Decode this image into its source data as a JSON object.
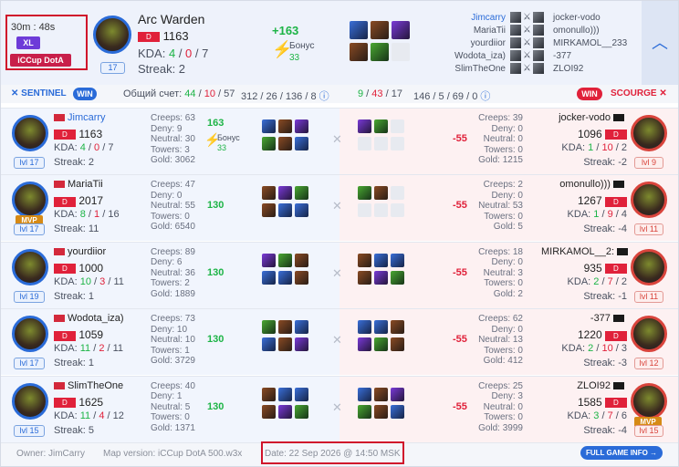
{
  "header": {
    "duration": "30m : 48s",
    "size_badge": "XL",
    "mode_badge": "iCCup DotA",
    "hero": "Arc Warden",
    "rating": "1163",
    "kda_label": "KDA:",
    "kda": [
      "4",
      "0",
      "7"
    ],
    "streak": "Streak: 2",
    "level": "17",
    "delta": "+163",
    "bonus_label": "Бонус",
    "bonus_value": "33"
  },
  "player_lists": {
    "left": [
      "Jimcarry",
      "MariaTii",
      "yourdiior",
      "Wodota_iza)",
      "SlimTheOne"
    ],
    "right": [
      "jocker-vodo",
      "omonullo)))",
      "MIRKAMOL__233",
      "-377",
      "ZLOI92"
    ]
  },
  "summary": {
    "sentinel": "SENTINEL",
    "win": "WIN",
    "score_label": "Общий счет:",
    "score": [
      "44",
      "10",
      "57"
    ],
    "left_stats": "312 / 26 / 136 / 8",
    "right_score": [
      "9",
      "43",
      "17"
    ],
    "right_stats": "146 / 5 / 69 / 0",
    "right_win": "WIN",
    "scourge": "SCOURGE"
  },
  "rows": [
    {
      "lname": "Jimcarry",
      "lrating": "1163",
      "lkda": [
        "4",
        "0",
        "7"
      ],
      "lstreak": "Streak: 2",
      "llvl": "lvl 17",
      "lstats": [
        "Creeps: 63",
        "Deny: 9",
        "Neutral: 30",
        "Towers: 3",
        "Gold: 3062"
      ],
      "ldelta": "163",
      "lbonus": "Бонус",
      "lbonusv": "33",
      "rstats": [
        "Creeps: 39",
        "Deny: 0",
        "Neutral: 0",
        "Towers: 0",
        "Gold: 1215"
      ],
      "rdelta": "-55",
      "rname": "jocker-vodo",
      "rrating": "1096",
      "rkda": [
        "1",
        "10",
        "2"
      ],
      "rstreak": "Streak: -2",
      "rlvl": "lvl 9"
    },
    {
      "lname": "MariaTii",
      "lrating": "2017",
      "lkda": [
        "8",
        "1",
        "16"
      ],
      "lstreak": "Streak: 11",
      "llvl": "lvl 17",
      "lmvp": "MVP",
      "lstats": [
        "Creeps: 47",
        "Deny: 0",
        "Neutral: 55",
        "Towers: 0",
        "Gold: 6540"
      ],
      "ldelta": "130",
      "rstats": [
        "Creeps: 2",
        "Deny: 0",
        "Neutral: 53",
        "Towers: 0",
        "Gold: 5"
      ],
      "rdelta": "-55",
      "rname": "omonullo)))",
      "rrating": "1267",
      "rkda": [
        "1",
        "9",
        "4"
      ],
      "rstreak": "Streak: -4",
      "rlvl": "lvl 11"
    },
    {
      "lname": "yourdiior",
      "lrating": "1000",
      "lkda": [
        "10",
        "3",
        "11"
      ],
      "lstreak": "Streak: 1",
      "llvl": "lvl 19",
      "lstats": [
        "Creeps: 89",
        "Deny: 6",
        "Neutral: 36",
        "Towers: 2",
        "Gold: 1889"
      ],
      "ldelta": "130",
      "rstats": [
        "Creeps: 18",
        "Deny: 0",
        "Neutral: 3",
        "Towers: 0",
        "Gold: 2"
      ],
      "rdelta": "-55",
      "rname": "MIRKAMOL__2:",
      "rrating": "935",
      "rkda": [
        "2",
        "7",
        "2"
      ],
      "rstreak": "Streak: -1",
      "rlvl": "lvl 11"
    },
    {
      "lname": "Wodota_iza)",
      "lrating": "1059",
      "lkda": [
        "11",
        "2",
        "11"
      ],
      "lstreak": "Streak: 1",
      "llvl": "lvl 17",
      "lstats": [
        "Creeps: 73",
        "Deny: 10",
        "Neutral: 10",
        "Towers: 1",
        "Gold: 3729"
      ],
      "ldelta": "130",
      "rstats": [
        "Creeps: 62",
        "Deny: 0",
        "Neutral: 13",
        "Towers: 0",
        "Gold: 412"
      ],
      "rdelta": "-55",
      "rname": "-377",
      "rrating": "1220",
      "rkda": [
        "2",
        "10",
        "3"
      ],
      "rstreak": "Streak: -3",
      "rlvl": "lvl 12"
    },
    {
      "lname": "SlimTheOne",
      "lrating": "1625",
      "lkda": [
        "11",
        "4",
        "12"
      ],
      "lstreak": "Streak: 5",
      "llvl": "lvl 15",
      "lstats": [
        "Creeps: 40",
        "Deny: 1",
        "Neutral: 5",
        "Towers: 0",
        "Gold: 1371"
      ],
      "ldelta": "130",
      "rstats": [
        "Creeps: 25",
        "Deny: 3",
        "Neutral: 0",
        "Towers: 0",
        "Gold: 3999"
      ],
      "rdelta": "-55",
      "rname": "ZLOI92",
      "rrating": "1585",
      "rkda": [
        "3",
        "7",
        "6"
      ],
      "rstreak": "Streak: -4",
      "rlvl": "lvl 15",
      "rmvp": "MVP"
    }
  ],
  "footer": {
    "owner": "Owner: JimCarry",
    "map": "Map version: iCCup DotA 500.w3x",
    "date": "Date: 22 Sep 2026 @ 14:50 MSK",
    "full_info": "FULL GAME INFO →"
  },
  "colors": {
    "sentinel": "#2a6bd8",
    "scourge": "#e0213a",
    "win_green": "#1db446",
    "highlight_box": "#d0142b"
  }
}
